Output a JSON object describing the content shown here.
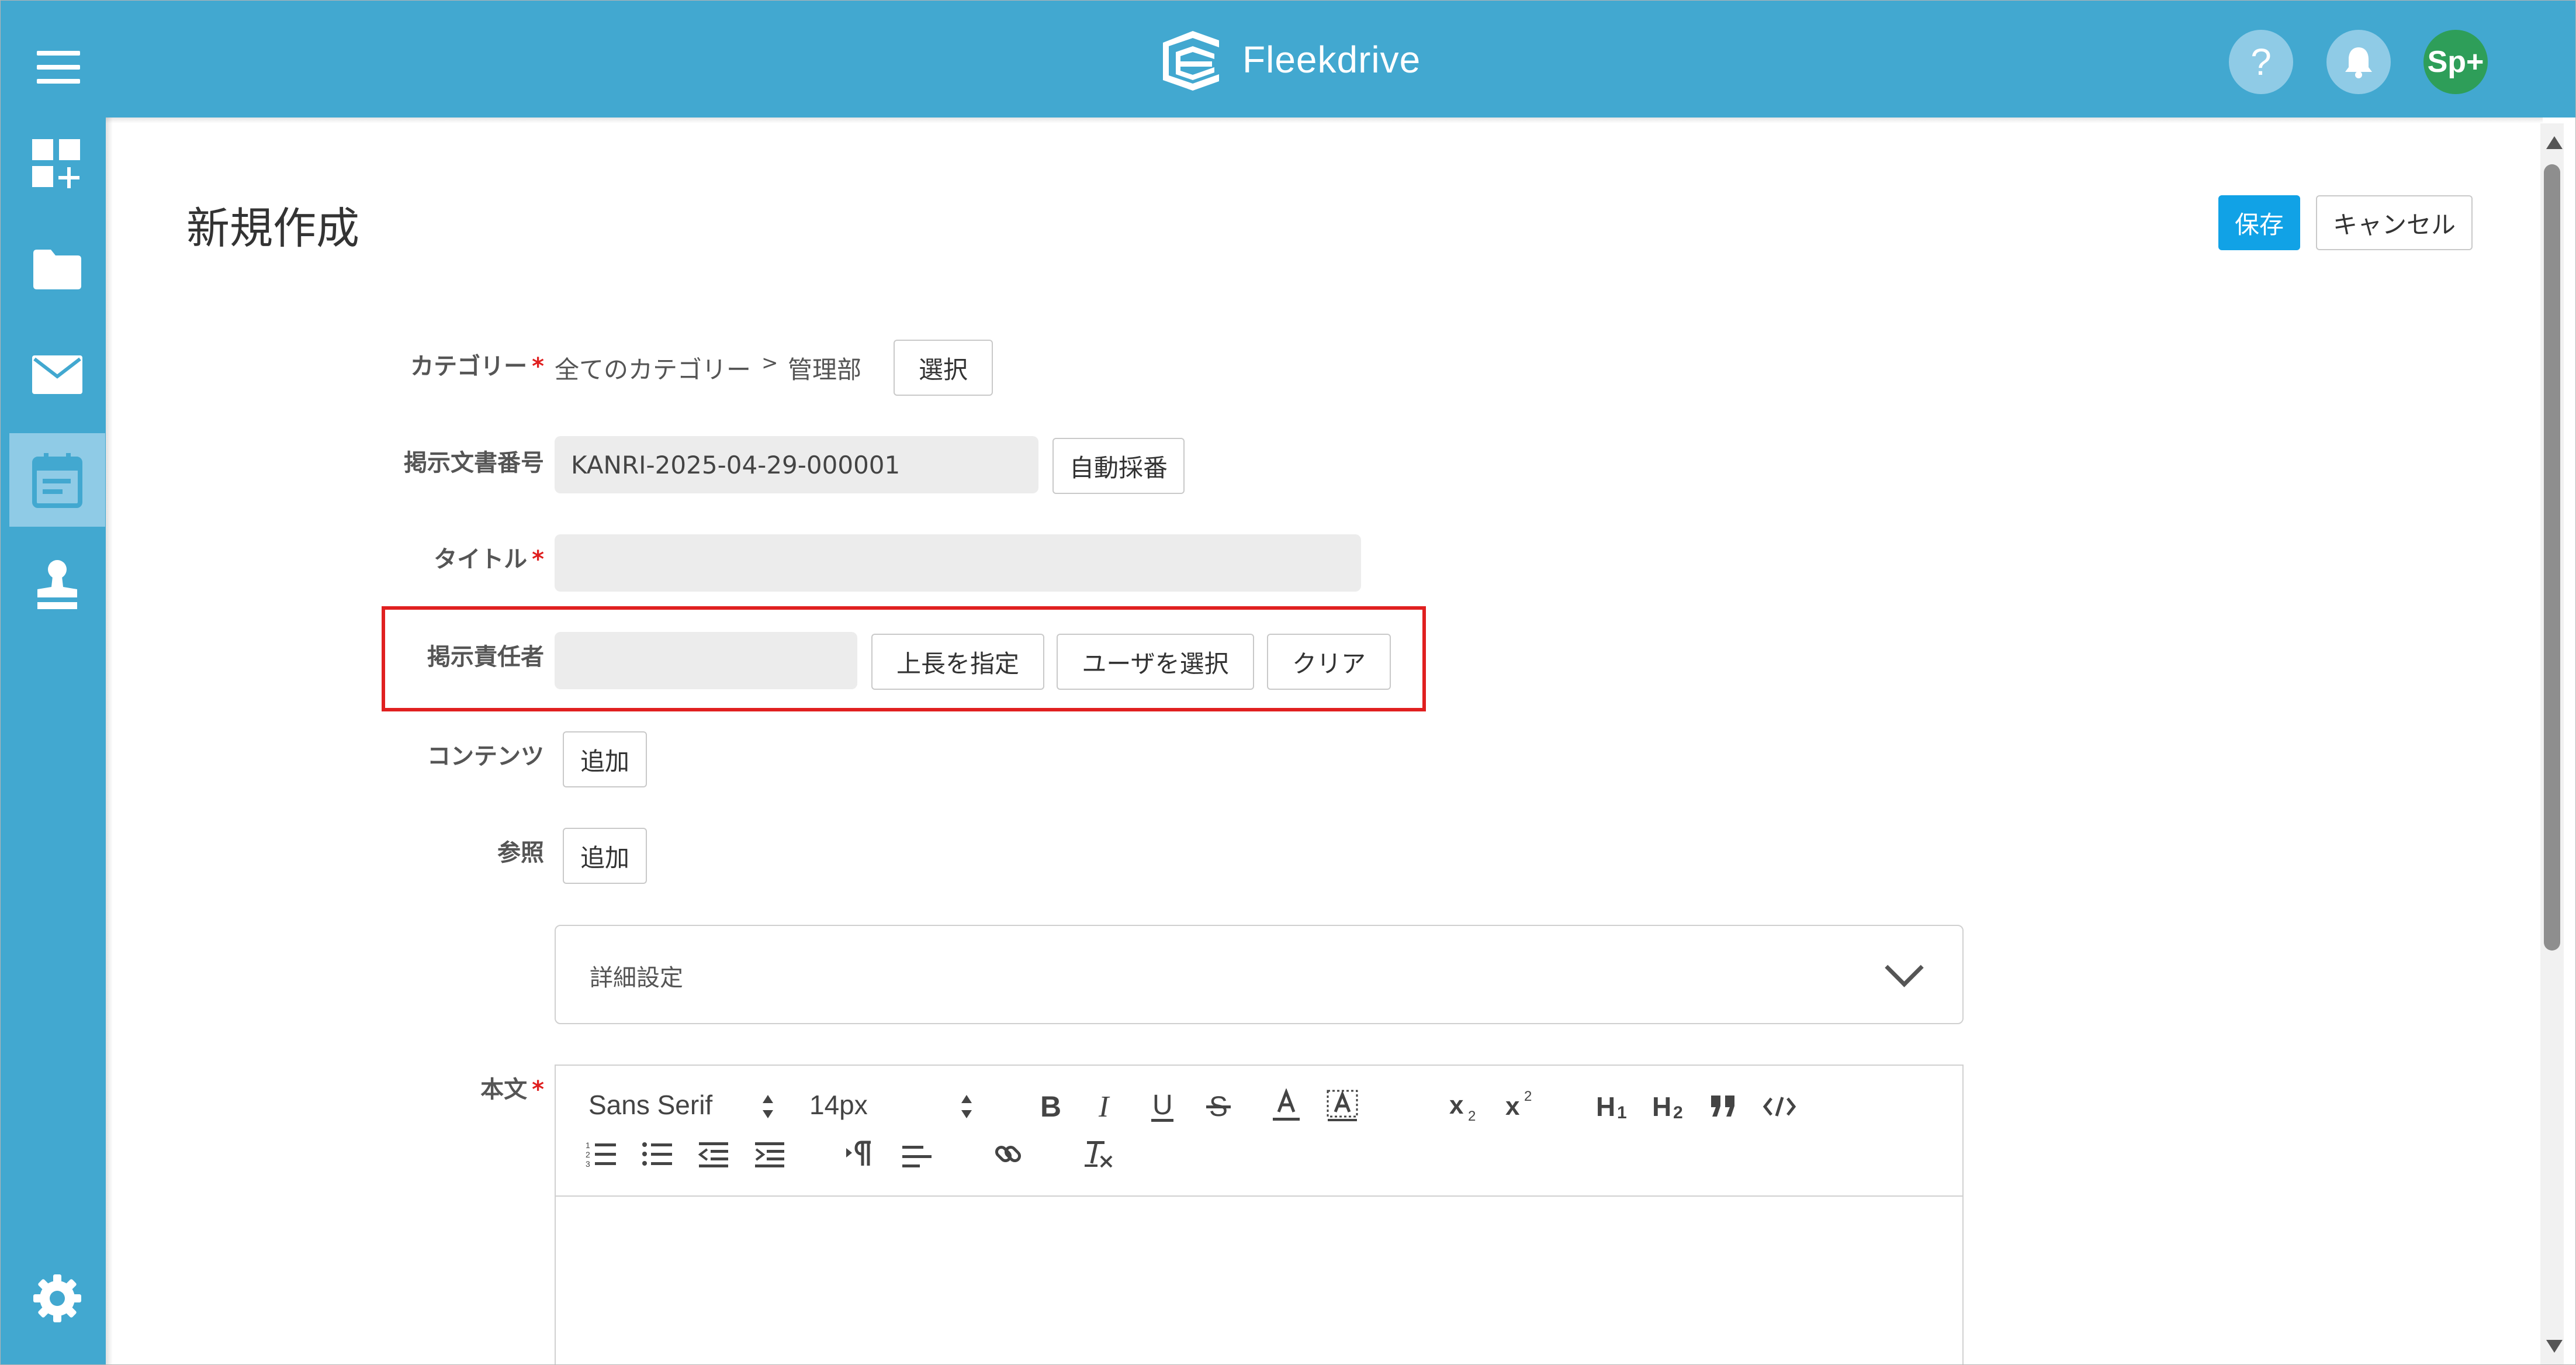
{
  "app": {
    "name": "Fleekdrive",
    "avatar_label": "Sp+",
    "help_label": "?"
  },
  "sidebar": {
    "items": [
      {
        "icon": "dashboard-add-icon",
        "active": false
      },
      {
        "icon": "folder-icon",
        "active": false
      },
      {
        "icon": "mail-icon",
        "active": false
      },
      {
        "icon": "calendar-icon",
        "active": true
      },
      {
        "icon": "stamp-icon",
        "active": false
      }
    ],
    "settings_icon": "gear-icon"
  },
  "page": {
    "title": "新規作成",
    "save_label": "保存",
    "cancel_label": "キャンセル"
  },
  "form": {
    "category": {
      "label": "カテゴリー",
      "required_mark": "*",
      "path_root": "全てのカテゴリー",
      "separator": ">",
      "path_leaf": "管理部",
      "select_label": "選択"
    },
    "doc_number": {
      "label": "掲示文書番号",
      "value": "KANRI-2025-04-29-000001",
      "auto_label": "自動採番"
    },
    "title": {
      "label": "タイトル",
      "required_mark": "*",
      "value": ""
    },
    "responsible": {
      "label": "掲示責任者",
      "value": "",
      "superior_label": "上長を指定",
      "select_user_label": "ユーザを選択",
      "clear_label": "クリア"
    },
    "contents": {
      "label": "コンテンツ",
      "add_label": "追加"
    },
    "reference": {
      "label": "参照",
      "add_label": "追加"
    },
    "details": {
      "label": "詳細設定"
    },
    "body": {
      "label": "本文",
      "required_mark": "*",
      "font_family": "Sans Serif",
      "font_size": "14px",
      "toolbar_icons": [
        "bold-icon",
        "italic-icon",
        "underline-icon",
        "strikethrough-icon",
        "font-color-icon",
        "background-color-icon",
        "subscript-icon",
        "superscript-icon",
        "heading-1-icon",
        "heading-2-icon",
        "blockquote-icon",
        "code-icon",
        "ordered-list-icon",
        "bullet-list-icon",
        "outdent-icon",
        "indent-icon",
        "text-direction-icon",
        "align-icon",
        "link-icon",
        "clear-format-icon"
      ]
    }
  },
  "colors": {
    "header": "#42a8d0",
    "sidebar_active": "#8fcbe6",
    "primary_button": "#11a2e6",
    "required": "#e02020",
    "avatar": "#2e9e59"
  }
}
